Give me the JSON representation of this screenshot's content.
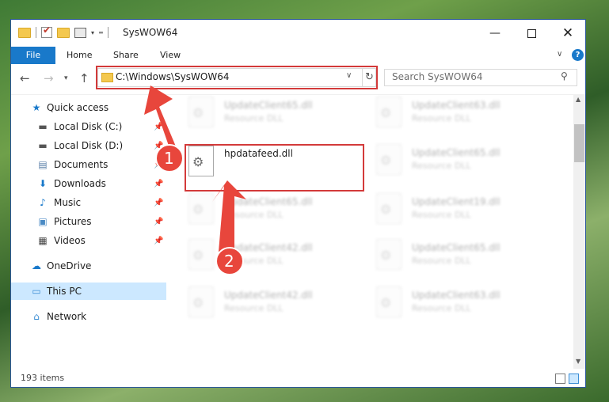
{
  "window": {
    "title": "SysWOW64"
  },
  "ribbon": {
    "file": "File",
    "home": "Home",
    "share": "Share",
    "view": "View",
    "help": "?"
  },
  "navigation": {
    "address": "C:\\Windows\\SysWOW64",
    "search_placeholder": "Search SysWOW64"
  },
  "sidebar": {
    "items": [
      {
        "label": "Quick access",
        "icon": "star-icon"
      },
      {
        "label": "Local Disk (C:)",
        "icon": "drive-icon",
        "pinned": true
      },
      {
        "label": "Local Disk (D:)",
        "icon": "drive-icon",
        "pinned": true
      },
      {
        "label": "Documents",
        "icon": "documents-icon",
        "pinned": true
      },
      {
        "label": "Downloads",
        "icon": "download-icon",
        "pinned": true
      },
      {
        "label": "Music",
        "icon": "music-icon",
        "pinned": true
      },
      {
        "label": "Pictures",
        "icon": "pictures-icon",
        "pinned": true
      },
      {
        "label": "Videos",
        "icon": "videos-icon",
        "pinned": true
      },
      {
        "label": "OneDrive",
        "icon": "cloud-icon"
      },
      {
        "label": "This PC",
        "icon": "computer-icon",
        "selected": true
      },
      {
        "label": "Network",
        "icon": "network-icon"
      }
    ]
  },
  "files": {
    "highlighted": {
      "name": "hpdatafeed.dll"
    },
    "col1": [
      {
        "name": "UpdateClient65.dll",
        "type": "Resource DLL"
      },
      {
        "name": "UpdateClient65.dll",
        "type": "Resource DLL"
      },
      {
        "name": "UpdateClient42.dll",
        "type": "Resource DLL"
      },
      {
        "name": "UpdateClient42.dll",
        "type": "Resource DLL"
      }
    ],
    "col2": [
      {
        "name": "UpdateClient63.dll",
        "type": "Resource DLL"
      },
      {
        "name": "UpdateClient65.dll",
        "type": "Resource DLL"
      },
      {
        "name": "UpdateClient19.dll",
        "type": "Resource DLL"
      },
      {
        "name": "UpdateClient65.dll",
        "type": "Resource DLL"
      },
      {
        "name": "UpdateClient63.dll",
        "type": "Resource DLL"
      }
    ]
  },
  "status": {
    "item_count": "193 items"
  },
  "callouts": {
    "step1": "1",
    "step2": "2"
  },
  "colors": {
    "accent": "#1979ca",
    "highlight": "#d33a3a"
  }
}
